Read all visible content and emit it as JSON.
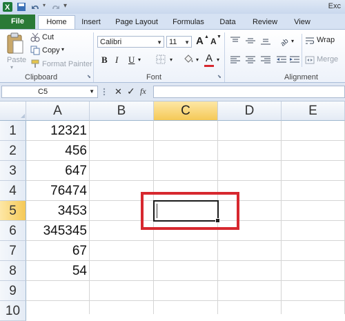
{
  "window": {
    "title": "Exc"
  },
  "tabs": {
    "file": "File",
    "items": [
      "Home",
      "Insert",
      "Page Layout",
      "Formulas",
      "Data",
      "Review",
      "View"
    ],
    "active": "Home"
  },
  "clipboard": {
    "paste": "Paste",
    "cut": "Cut",
    "copy": "Copy",
    "format_painter": "Format Painter",
    "group": "Clipboard"
  },
  "font": {
    "name": "Calibri",
    "size": "11",
    "bold": "B",
    "italic": "I",
    "underline": "U",
    "grow": "A",
    "shrink": "A",
    "font_color": "A",
    "group": "Font"
  },
  "alignment": {
    "wrap": "Wrap",
    "merge": "Merge",
    "group": "Alignment"
  },
  "formula_bar": {
    "name_box": "C5",
    "cancel": "✕",
    "enter": "✓",
    "fx": "fx",
    "content": ""
  },
  "columns": [
    "A",
    "B",
    "C",
    "D",
    "E"
  ],
  "selected_column": "C",
  "rows": [
    {
      "num": "1",
      "a": "12321"
    },
    {
      "num": "2",
      "a": "456"
    },
    {
      "num": "3",
      "a": "647"
    },
    {
      "num": "4",
      "a": "76474"
    },
    {
      "num": "5",
      "a": "3453"
    },
    {
      "num": "6",
      "a": "345345"
    },
    {
      "num": "7",
      "a": "67"
    },
    {
      "num": "8",
      "a": "54"
    },
    {
      "num": "9",
      "a": ""
    },
    {
      "num": "10",
      "a": ""
    }
  ],
  "selected_row": "5",
  "colors": {
    "file_tab": "#2a7a36",
    "highlight_box": "#d7282f",
    "selected_header": "#f5c957"
  }
}
